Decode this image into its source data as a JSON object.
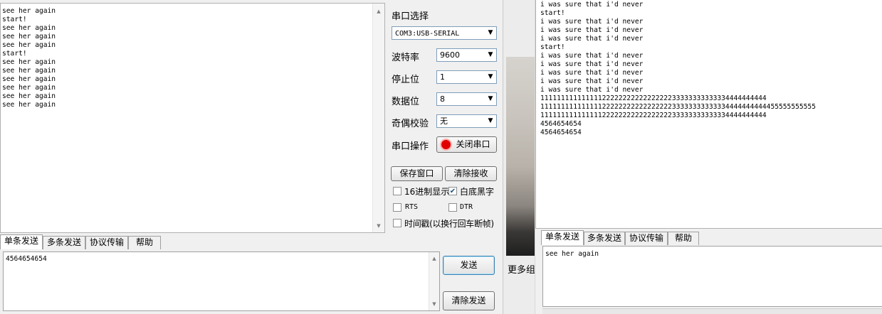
{
  "left": {
    "receive_lines": [
      "see her again",
      "start!",
      "see her again",
      "see her again",
      "see her again",
      "start!",
      "see her again",
      "see her again",
      "see her again",
      "see her again",
      "see her again",
      "see her again"
    ],
    "send_text": "4564654654",
    "tabs": [
      "单条发送",
      "多条发送",
      "协议传输",
      "帮助"
    ],
    "send_button": "发送",
    "clear_send_button": "清除发送"
  },
  "settings": {
    "port_label": "串口选择",
    "port_value": "COM3:USB-SERIAL",
    "baud_label": "波特率",
    "baud_value": "9600",
    "stop_label": "停止位",
    "stop_value": "1",
    "data_label": "数据位",
    "data_value": "8",
    "parity_label": "奇偶校验",
    "parity_value": "无",
    "op_label": "串口操作",
    "close_port_button": "关闭串口",
    "save_window_button": "保存窗口",
    "clear_recv_button": "清除接收",
    "hex_display_label": "16进制显示",
    "hex_display_checked": false,
    "white_bg_label": "白底黑字",
    "white_bg_checked": true,
    "rts_label": "RTS",
    "rts_checked": false,
    "dtr_label": "DTR",
    "dtr_checked": false,
    "timestamp_label": "时间戳(以换行回车断帧)",
    "timestamp_checked": false,
    "port_open_color": "#e00000"
  },
  "middle": {
    "partial_text": "更多组"
  },
  "right": {
    "receive_lines": [
      "i was sure that i'd never",
      "start!",
      "i was sure that i'd never",
      "i was sure that i'd never",
      "i was sure that i'd never",
      "start!",
      "i was sure that i'd never",
      "i was sure that i'd never",
      "i was sure that i'd never",
      "i was sure that i'd never",
      "i was sure that i'd never",
      "1111111111111112222222222222222233333333333334444444444",
      "1111111111111112222222222222222233333333333334444444444455555555555",
      "1111111111111112222222222222222233333333333334444444444",
      "4564654654",
      "4564654654"
    ],
    "tabs": [
      "单条发送",
      "多条发送",
      "协议传输",
      "帮助"
    ],
    "send_text": "see her again"
  }
}
